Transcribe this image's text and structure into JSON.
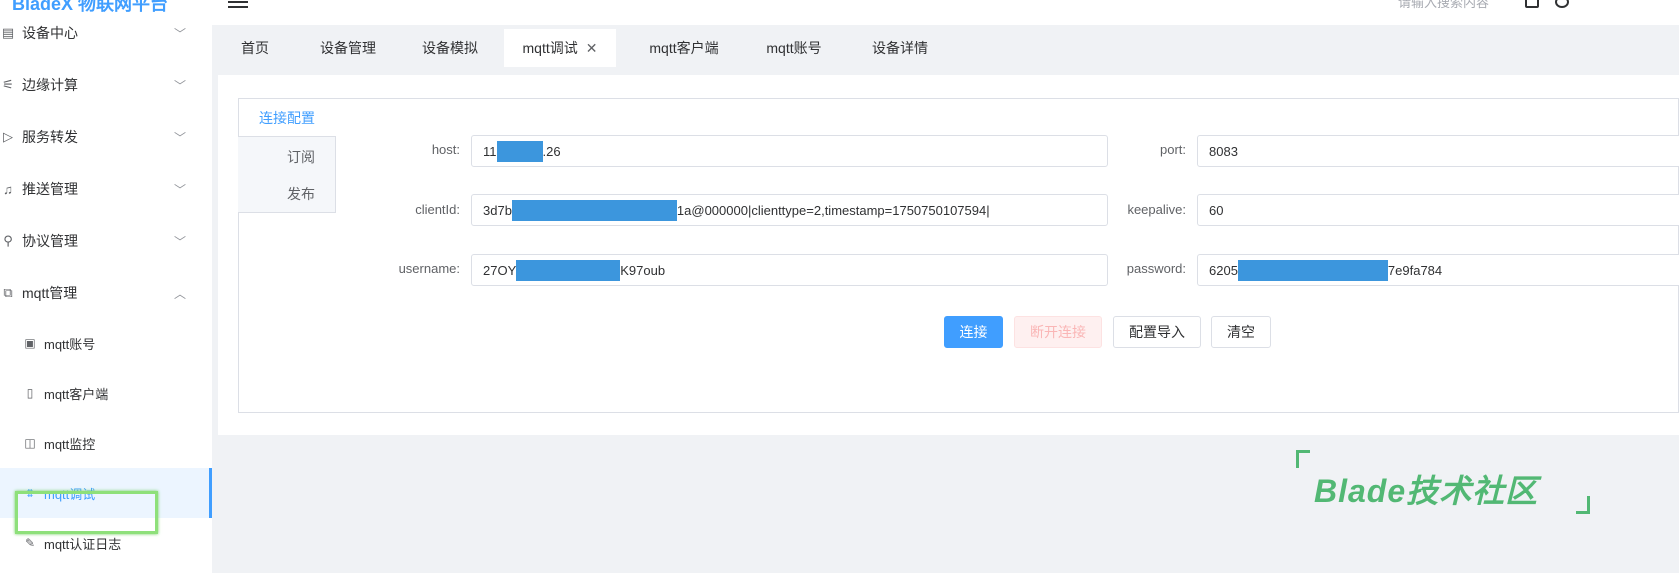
{
  "app": {
    "logo": "BladeX 物联网平台"
  },
  "header": {
    "search_placeholder": "请输入搜索内容"
  },
  "sidebar": {
    "items": [
      {
        "label": "设备中心",
        "icon": "device-icon",
        "expanded": false
      },
      {
        "label": "边缘计算",
        "icon": "edge-icon",
        "expanded": false
      },
      {
        "label": "服务转发",
        "icon": "send-icon",
        "expanded": false
      },
      {
        "label": "推送管理",
        "icon": "bell-icon",
        "expanded": false
      },
      {
        "label": "协议管理",
        "icon": "antenna-icon",
        "expanded": false
      },
      {
        "label": "mqtt管理",
        "icon": "mqtt-icon",
        "expanded": true
      }
    ],
    "subitems": [
      {
        "label": "mqtt账号",
        "icon": "id-card-icon"
      },
      {
        "label": "mqtt客户端",
        "icon": "phone-icon"
      },
      {
        "label": "mqtt监控",
        "icon": "camera-icon"
      },
      {
        "label": "mqtt调试",
        "icon": "debug-icon",
        "active": true
      },
      {
        "label": "mqtt认证日志",
        "icon": "edit-icon"
      }
    ]
  },
  "tabs": [
    {
      "label": "首页"
    },
    {
      "label": "设备管理"
    },
    {
      "label": "设备模拟"
    },
    {
      "label": "mqtt调试",
      "active": true,
      "closable": true
    },
    {
      "label": "mqtt客户端"
    },
    {
      "label": "mqtt账号"
    },
    {
      "label": "设备详情"
    }
  ],
  "config": {
    "title": "连接配置",
    "side_tabs": [
      "订阅",
      "发布"
    ],
    "host_label": "host:",
    "host_prefix": "11",
    "host_suffix": ".26",
    "port_label": "port:",
    "port_value": "8083",
    "clientid_label": "clientId:",
    "clientid_prefix": "3d7b",
    "clientid_suffix": "1a@000000|clienttype=2,timestamp=1750750107594|",
    "keepalive_label": "keepalive:",
    "keepalive_value": "60",
    "username_label": "username:",
    "username_prefix": "27OY",
    "username_suffix": "K97oub",
    "password_label": "password:",
    "password_prefix": "6205",
    "password_suffix": "7e9fa784"
  },
  "buttons": {
    "connect": "连接",
    "disconnect": "断开连接",
    "import": "配置导入",
    "clear": "清空"
  },
  "watermark": {
    "text": "Blade技术社区"
  },
  "colors": {
    "primary": "#409eff",
    "mask": "#3c96dd",
    "watermark": "#52b874",
    "highlight": "#8ee07a"
  }
}
